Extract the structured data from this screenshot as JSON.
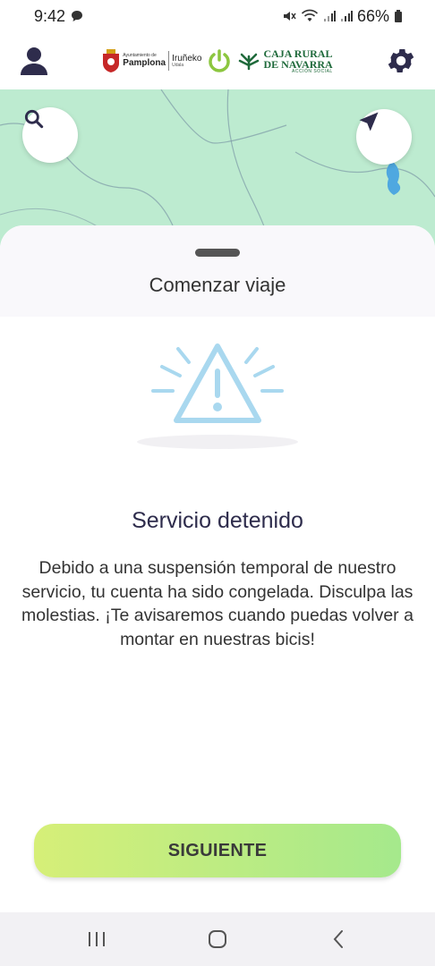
{
  "status_bar": {
    "time": "9:42",
    "battery": "66%",
    "icons": [
      "chat-notification-icon",
      "mute-icon",
      "wifi-icon",
      "signal-icon",
      "signal-icon",
      "battery-icon"
    ]
  },
  "header": {
    "profile_icon": "person-icon",
    "settings_icon": "gear-icon",
    "logo_pamplona_small": "Ayuntamiento de",
    "logo_pamplona": "Pamplona",
    "logo_irunoko": "Iruñeko",
    "logo_irunoko_small": "Udala",
    "logo_caja_line1": "CAJA RURAL",
    "logo_caja_line2": "DE NAVARRA",
    "logo_caja_small": "ACCIÓN SOCIAL"
  },
  "map": {
    "search_icon": "search-icon",
    "locate_icon": "navigation-arrow-icon"
  },
  "sheet": {
    "title": "Comenzar viaje",
    "illustration_icon": "warning-icon",
    "message_title": "Servicio detenido",
    "message_body": "Debido a una suspensión temporal de nuestro servicio, tu cuenta ha sido congelada. Disculpa las molestias. ¡Te avisaremos cuando puedas volver a montar en nuestras bicis!",
    "button_label": "SIGUIENTE"
  },
  "colors": {
    "map_green": "#bdebd0",
    "brand_navy": "#2e2c4c",
    "button_start": "#d6ef78",
    "button_end": "#a5e98c",
    "warning_blue": "#a9d8ef"
  }
}
